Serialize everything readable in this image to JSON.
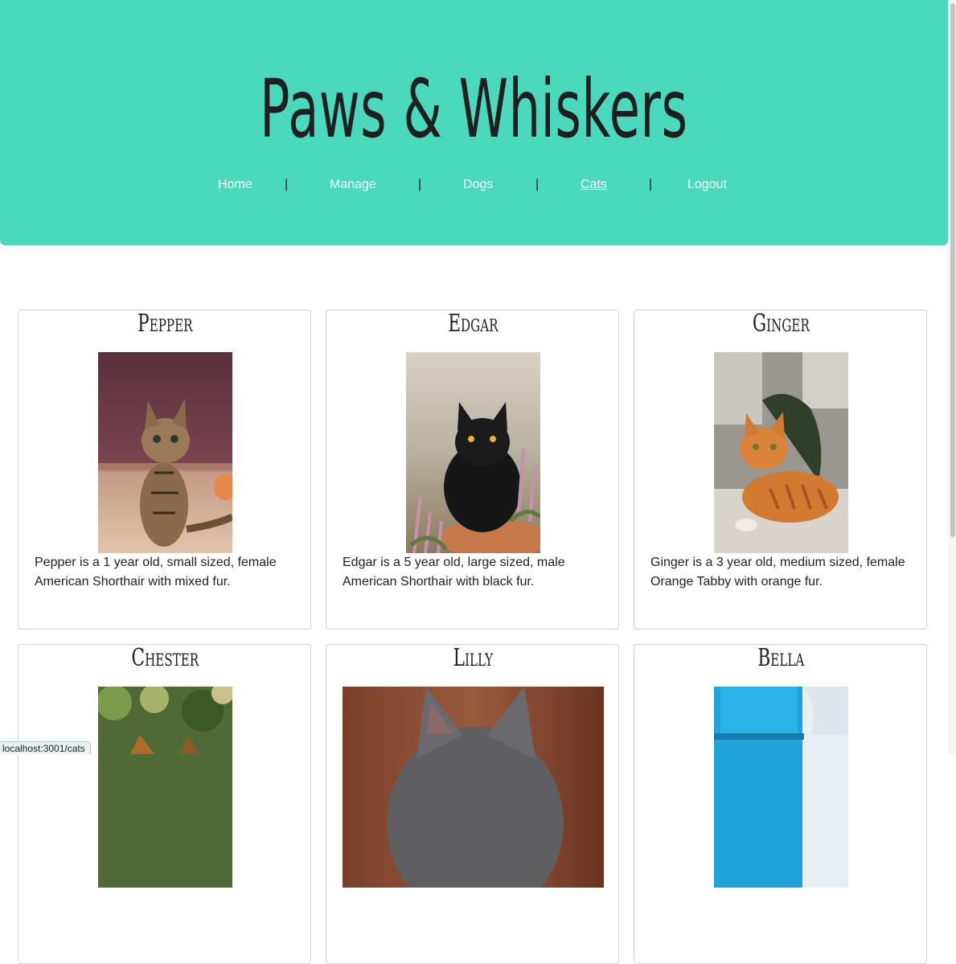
{
  "site": {
    "title": "Paws & Whiskers"
  },
  "nav": {
    "items": [
      {
        "label": "Home"
      },
      {
        "label": "Manage"
      },
      {
        "label": "Dogs"
      },
      {
        "label": "Cats",
        "active": true
      },
      {
        "label": "Logout"
      }
    ],
    "separator": "|"
  },
  "cats": [
    {
      "name": "Pepper",
      "description": "Pepper is a 1 year old, small sized, female American Shorthair with mixed fur.",
      "photo": "tabby-kitten-photo"
    },
    {
      "name": "Edgar",
      "description": "Edgar is a 5 year old, large sized, male American Shorthair with black fur.",
      "photo": "black-cat-photo"
    },
    {
      "name": "Ginger",
      "description": "Ginger is a 3 year old, medium sized, female Orange Tabby with orange fur.",
      "photo": "orange-tabby-photo"
    },
    {
      "name": "Chester",
      "description": "",
      "photo": "outdoor-cat-photo"
    },
    {
      "name": "Lilly",
      "description": "",
      "photo": "gray-cat-photo"
    },
    {
      "name": "Bella",
      "description": "",
      "photo": "blue-door-cat-photo"
    }
  ],
  "status_bar": {
    "url": "localhost:3001/cats"
  },
  "colors": {
    "header_background": "#4ad9bc",
    "nav_link": "#ffffff",
    "text": "#1f1f1f"
  }
}
